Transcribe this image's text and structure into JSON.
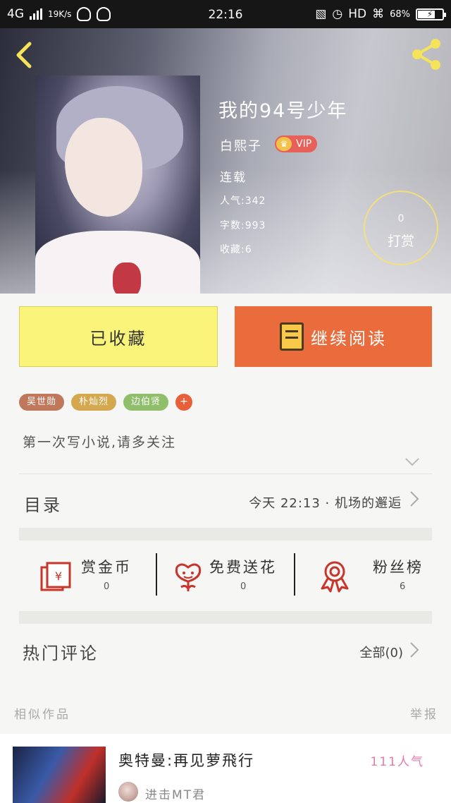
{
  "status_bar": {
    "network": "4G",
    "speed": "19K/s",
    "time": "22:16",
    "hd": "HD",
    "battery": "68%"
  },
  "book": {
    "title": "我的94号少年",
    "author": "白熙子",
    "vip": "VIP",
    "status": "连载",
    "popularity": "人气:342",
    "word_count": "字数:993",
    "favorites": "收藏:6",
    "tip_count": "0",
    "tip_label": "打赏"
  },
  "actions": {
    "favorited_label": "已收藏",
    "continue_label": "继续阅读"
  },
  "tags": [
    "吴世勋",
    "朴灿烈",
    "边伯贤"
  ],
  "tag_add": "+",
  "intro": "第一次写小说,请多关注",
  "toc": {
    "label": "目录",
    "latest": "今天 22:13 · 机场的邂逅"
  },
  "features": [
    {
      "name": "赏金币",
      "count": "0",
      "icon": "red-envelope-icon"
    },
    {
      "name": "免费送花",
      "count": "0",
      "icon": "flower-icon"
    },
    {
      "name": "粉丝榜",
      "count": "6",
      "icon": "medal-icon"
    }
  ],
  "comments": {
    "label": "热门评论",
    "all": "全部(0)"
  },
  "similar": {
    "heading": "相似作品",
    "report": "举报",
    "item": {
      "title": "奥特曼:再见萝飛行",
      "popularity": "111人气",
      "author": "进击MT君"
    }
  },
  "colors": {
    "accent_orange": "#ea6b3b",
    "favorite_yellow": "#fbf47a",
    "icon_red": "#c8352a",
    "popularity_pink": "#e879a8"
  }
}
